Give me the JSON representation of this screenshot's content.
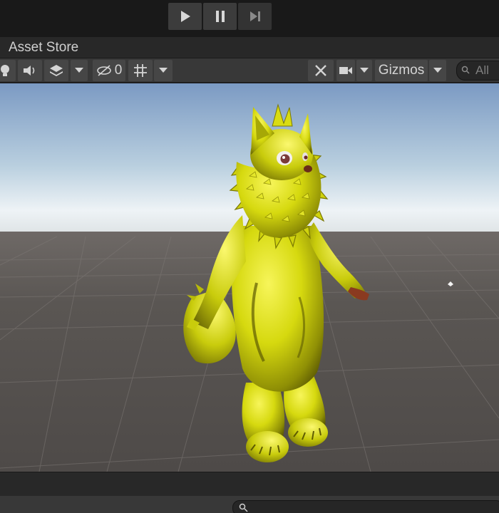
{
  "play_controls": {
    "play_icon": "play-icon",
    "pause_icon": "pause-icon",
    "step_icon": "step-icon"
  },
  "tab": {
    "label": "Asset Store"
  },
  "toolbar": {
    "hidden_count": "0",
    "gizmos_label": "Gizmos",
    "search_placeholder": "All",
    "icons": [
      "lighting-icon",
      "audio-icon",
      "effects-layers-icon",
      "dropdown-icon",
      "visibility-icon",
      "grid-icon",
      "dropdown-icon",
      "tools-icon",
      "camera-icon",
      "dropdown-icon",
      "dropdown-icon",
      "search-icon"
    ]
  },
  "scene": {
    "object_description_icon": "character-model",
    "colors": {
      "sky_top": "#7b9ac3",
      "horizon": "#f0f4f6",
      "ground": "#5b5754",
      "model": "#d6d90f"
    }
  },
  "bottom": {
    "search_icon": "search-icon"
  }
}
